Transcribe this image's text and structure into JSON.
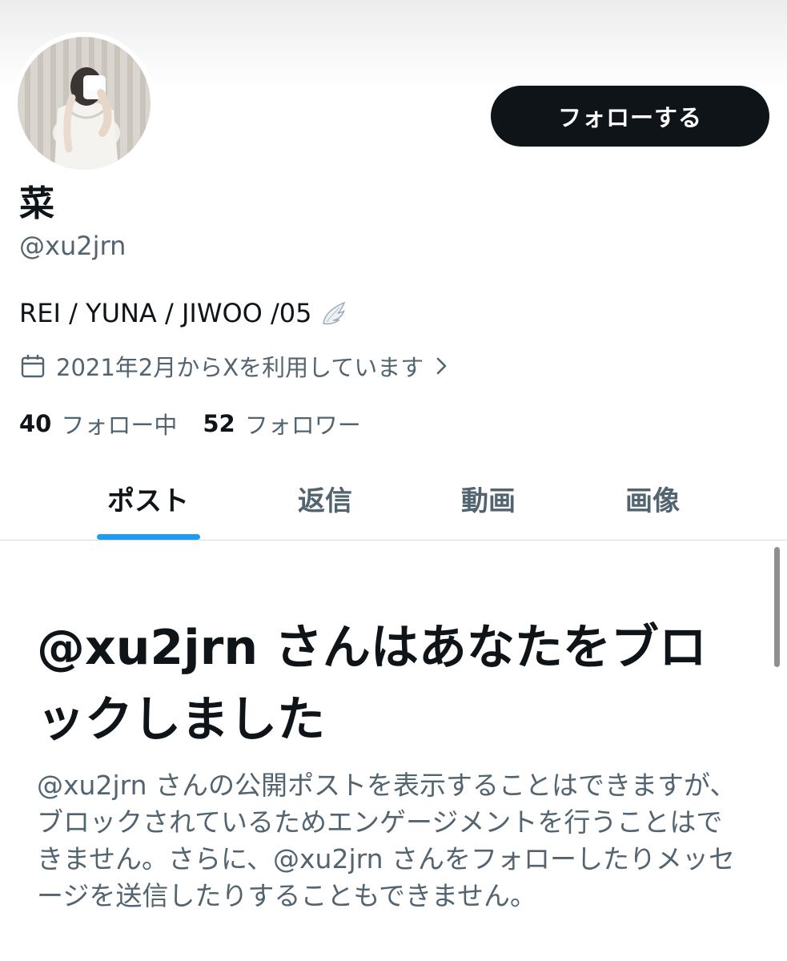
{
  "profile": {
    "display_name": "菜",
    "handle": "@xu2jrn",
    "bio": "REI / YUNA / JIWOO /05",
    "bio_emoji": "wing-emoji",
    "joined": "2021年2月からXを利用しています",
    "following_count": "40",
    "following_label": "フォロー中",
    "followers_count": "52",
    "followers_label": "フォロワー"
  },
  "actions": {
    "follow_label": "フォローする"
  },
  "tabs": [
    {
      "label": "ポスト",
      "active": true
    },
    {
      "label": "返信",
      "active": false
    },
    {
      "label": "動画",
      "active": false
    },
    {
      "label": "画像",
      "active": false
    }
  ],
  "blocked": {
    "title": "@xu2jrn さんはあなたをブロックしました",
    "body": "@xu2jrn さんの公開ポストを表示することはできますが、ブロックされているためエンゲージメントを行うことはできません。さらに、@xu2jrn さんをフォローしたりメッセージを送信したりすることもできません。"
  },
  "colors": {
    "accent": "#1d9bf0",
    "text_primary": "#0f1419",
    "text_secondary": "#536471",
    "button_bg": "#0f1419"
  },
  "icons": {
    "calendar": "calendar-icon",
    "chevron": "chevron-right-icon"
  }
}
